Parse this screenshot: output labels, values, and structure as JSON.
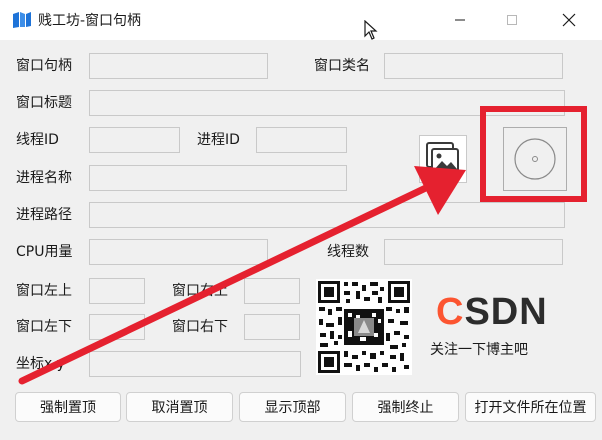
{
  "window": {
    "title": "贱工坊-窗口句柄",
    "controls": {
      "minimize": "minimize",
      "maximize": "maximize",
      "close": "close"
    }
  },
  "fields": {
    "window_handle": {
      "label": "窗口句柄",
      "value": ""
    },
    "window_class": {
      "label": "窗口类名",
      "value": ""
    },
    "window_title": {
      "label": "窗口标题",
      "value": ""
    },
    "thread_id": {
      "label": "线程ID",
      "value": ""
    },
    "process_id": {
      "label": "进程ID",
      "value": ""
    },
    "process_name": {
      "label": "进程名称",
      "value": ""
    },
    "process_path": {
      "label": "进程路径",
      "value": ""
    },
    "cpu_usage": {
      "label": "CPU用量",
      "value": ""
    },
    "thread_count": {
      "label": "线程数",
      "value": ""
    },
    "top_left_label": "窗口左上",
    "top_right_label": "窗口右上",
    "bottom_left_label": "窗口左下",
    "bottom_right_label": "窗口右下",
    "coords_label": "坐标x,y"
  },
  "promo": {
    "logo_c": "C",
    "logo_rest": "SDN",
    "follow_text": "关注一下博主吧"
  },
  "buttons": {
    "force_top": "强制置顶",
    "cancel_top": "取消置顶",
    "show_top": "显示顶部",
    "force_terminate": "强制终止",
    "open_location": "打开文件所在位置"
  },
  "icons": {
    "app": "app-logo-icon",
    "picture": "picture-icon",
    "target": "crosshair-target-icon",
    "qr": "qr-code"
  },
  "colors": {
    "annotation_red": "#e5212f",
    "csdn_orange": "#fc5531",
    "app_blue": "#1e73d8"
  }
}
